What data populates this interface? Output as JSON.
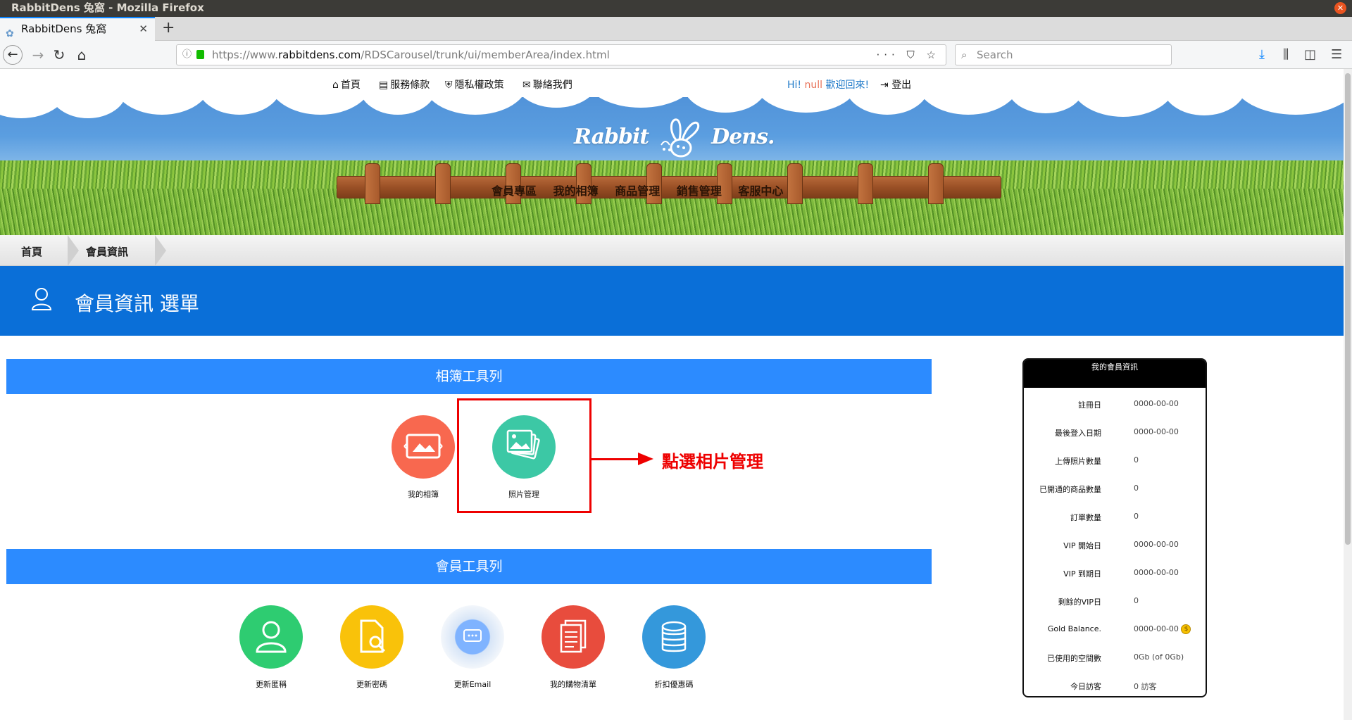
{
  "window": {
    "title": "RabbitDens 兔窩 - Mozilla Firefox"
  },
  "tab": {
    "title": "RabbitDens 兔窩"
  },
  "url": {
    "prefix": "https://www.",
    "host": "rabbitdens.com",
    "path": "/RDSCarousel/trunk/ui/memberArea/index.html"
  },
  "search": {
    "placeholder": "Search"
  },
  "topnav": {
    "home": "首頁",
    "terms": "服務條款",
    "privacy": "隱私權政策",
    "contact": "聯絡我們",
    "hi": "Hi!",
    "user": "null",
    "welcome": "歡迎回來!",
    "logout": "登出"
  },
  "logo": {
    "left": "Rabbit",
    "right": "Dens."
  },
  "fence_menu": [
    "會員專區",
    "我的相簿",
    "商品管理",
    "銷售管理",
    "客服中心"
  ],
  "breadcrumb": [
    "首頁",
    "會員資訊"
  ],
  "header": {
    "title": "會員資訊 選單"
  },
  "album_toolbar": {
    "title": "相簿工具列",
    "items": [
      {
        "label": "我的相簿",
        "color": "#f8684f"
      },
      {
        "label": "照片管理",
        "color": "#3cc8a5"
      }
    ]
  },
  "annotation": {
    "text": "點選相片管理",
    "color": "#ee0000"
  },
  "member_toolbar": {
    "title": "會員工具列",
    "items": [
      {
        "label": "更新匿稱",
        "color": "#2ecc71"
      },
      {
        "label": "更新密碼",
        "color": "#f9c20a"
      },
      {
        "label": "更新Email",
        "color": "#5b8fd8"
      },
      {
        "label": "我的購物清單",
        "color": "#e84c3d"
      },
      {
        "label": "折扣優惠碼",
        "color": "#3498db"
      }
    ]
  },
  "member_info": {
    "title": "我的會員資訊",
    "rows": [
      {
        "key": "註冊日",
        "value": "0000-00-00"
      },
      {
        "key": "最後登入日期",
        "value": "0000-00-00"
      },
      {
        "key": "上傳照片數量",
        "value": "0"
      },
      {
        "key": "已開通的商品數量",
        "value": "0"
      },
      {
        "key": "訂單數量",
        "value": "0"
      },
      {
        "key": "VIP 開始日",
        "value": "0000-00-00"
      },
      {
        "key": "VIP 到期日",
        "value": "0000-00-00"
      },
      {
        "key": "剩餘的VIP日",
        "value": "0"
      },
      {
        "key": "Gold Balance.",
        "value": "0000-00-00"
      },
      {
        "key": "已使用的空間數",
        "value": "0Gb (of 0Gb)"
      },
      {
        "key": "今日訪客",
        "value": "0 訪客"
      }
    ]
  }
}
